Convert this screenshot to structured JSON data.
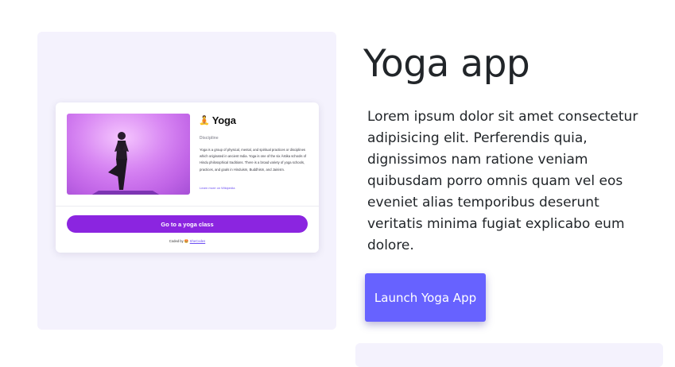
{
  "preview": {
    "card": {
      "emoji": "🧘",
      "title": "Yoga",
      "discipline_label": "Discipline",
      "description": "Yoga is a group of physical, mental, and spiritual practices or disciplines which originated in ancient India. Yoga is one of the six Āstika schools of Hindu philosophical traditions. There is a broad variety of yoga schools, practices, and goals in Hinduism, Buddhism, and Jainism.",
      "learn_more": "Learn more on Wikipedia",
      "button_label": "Go to a yoga class",
      "coded_by_prefix": "Coded by",
      "coded_by_heart": "🤩",
      "coded_by_link": "SheCodes"
    }
  },
  "project": {
    "title": "Yoga app",
    "description": "Lorem ipsum dolor sit amet consectetur adipisicing elit. Perferendis quia, dignissimos nam ratione veniam quibusdam porro omnis quam vel eos eveniet alias temporibus deserunt veritatis minima fugiat explicabo eum dolore.",
    "launch_label": "Launch Yoga App"
  },
  "colors": {
    "panel_bg": "#f4f2fd",
    "card_button": "#8b25e0",
    "launch_button": "#6762ff",
    "link": "#6c4ef2",
    "text": "#212529"
  }
}
